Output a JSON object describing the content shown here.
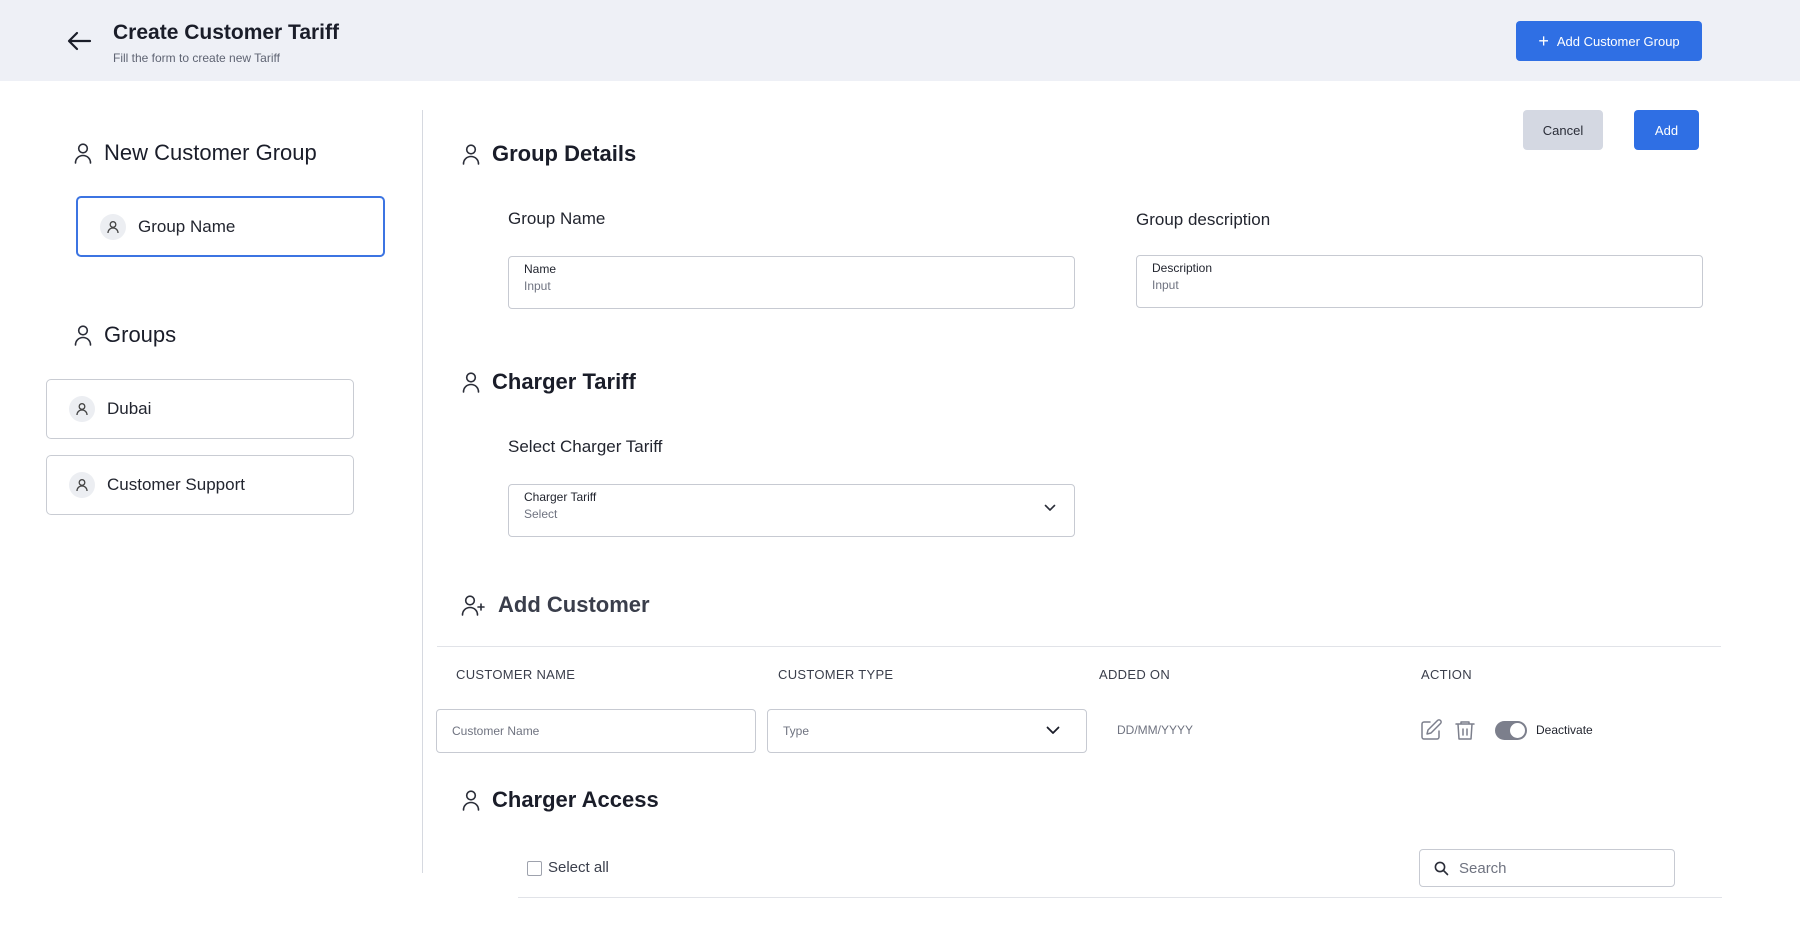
{
  "header": {
    "title": "Create Customer Tariff",
    "subtitle": "Fill the form to create new Tariff",
    "add_group_label": "Add Customer Group"
  },
  "sidebar": {
    "new_group_heading": "New Customer Group",
    "new_group_card": "Group Name",
    "groups_heading": "Groups",
    "groups": [
      "Dubai",
      "Customer Support"
    ]
  },
  "actions": {
    "cancel_label": "Cancel",
    "add_label": "Add"
  },
  "group_details": {
    "heading": "Group Details",
    "name_label": "Group Name",
    "name_caption": "Name",
    "name_placeholder": "Input",
    "desc_label": "Group description",
    "desc_caption": "Description",
    "desc_placeholder": "Input"
  },
  "charger_tariff": {
    "heading": "Charger Tariff",
    "select_label": "Select Charger Tariff",
    "select_caption": "Charger Tariff",
    "select_value": "Select"
  },
  "add_customer": {
    "heading": "Add Customer",
    "columns": [
      "CUSTOMER NAME",
      "CUSTOMER TYPE",
      "ADDED ON",
      "ACTION"
    ],
    "row": {
      "name_placeholder": "Customer Name",
      "type_placeholder": "Type",
      "date_placeholder": "DD/MM/YYYY",
      "toggle_label": "Deactivate",
      "toggle_on": true
    }
  },
  "charger_access": {
    "heading": "Charger Access",
    "select_all_label": "Select all",
    "search_placeholder": "Search"
  },
  "colors": {
    "primary": "#2f6fe4",
    "header_bg": "#eef0f6",
    "active_border": "#3c74e2",
    "toggle_track": "#7c7f8c"
  },
  "icons": [
    "arrow-left-icon",
    "plus-icon",
    "user-icon",
    "user-plus-icon",
    "chevron-down-icon",
    "edit-icon",
    "trash-icon",
    "search-icon"
  ]
}
